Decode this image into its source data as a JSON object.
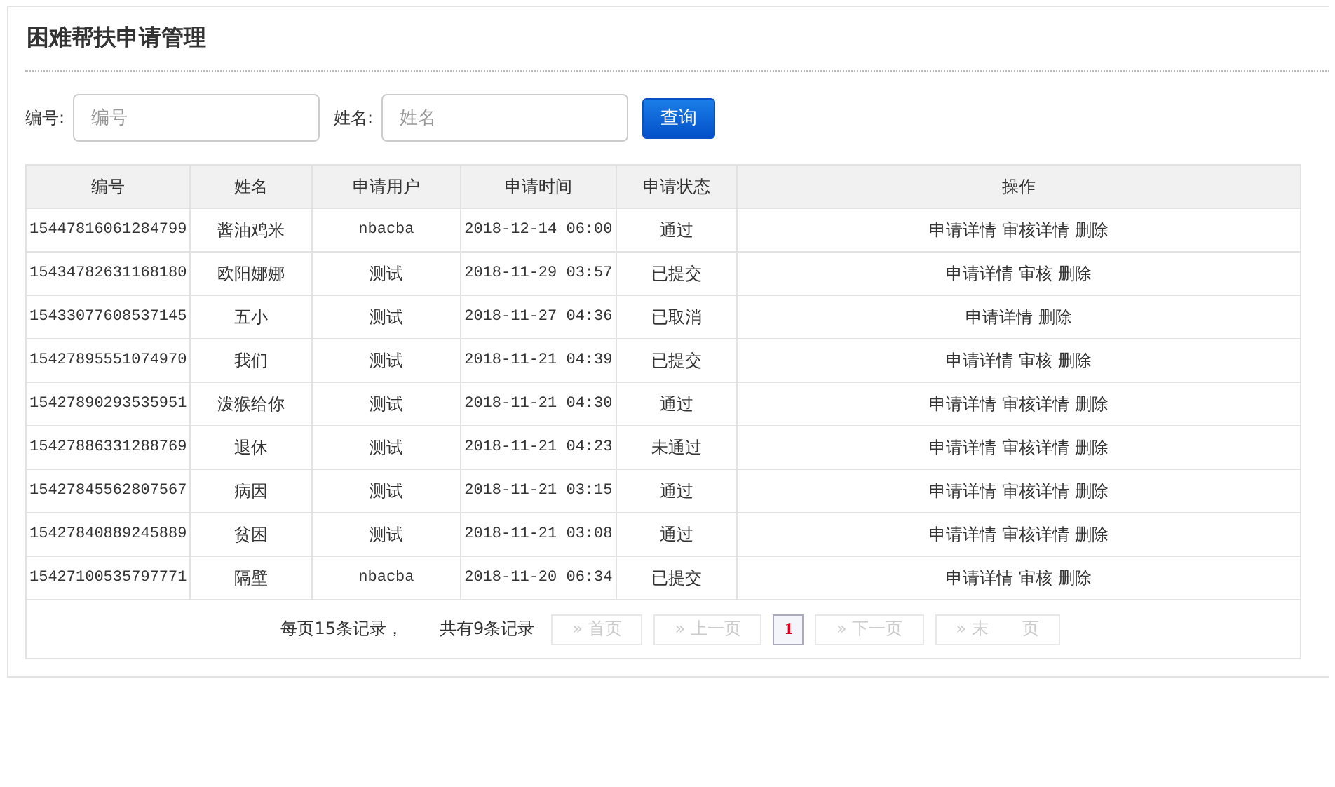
{
  "title": "困难帮扶申请管理",
  "search": {
    "fields": [
      {
        "label": "编号:",
        "placeholder": "编号"
      },
      {
        "label": "姓名:",
        "placeholder": "姓名"
      }
    ],
    "button": "查询"
  },
  "table": {
    "columns": [
      "编号",
      "姓名",
      "申请用户",
      "申请时间",
      "申请状态",
      "操作"
    ],
    "rows": [
      {
        "id": "15447816061284799",
        "name": "酱油鸡米",
        "user": "nbacba",
        "time": "2018-12-14 06:00",
        "status": "通过",
        "actions": [
          "申请详情",
          "审核详情",
          "删除"
        ]
      },
      {
        "id": "15434782631168180",
        "name": "欧阳娜娜",
        "user": "测试",
        "time": "2018-11-29 03:57",
        "status": "已提交",
        "actions": [
          "申请详情",
          "审核",
          "删除"
        ]
      },
      {
        "id": "15433077608537145",
        "name": "五小",
        "user": "测试",
        "time": "2018-11-27 04:36",
        "status": "已取消",
        "actions": [
          "申请详情",
          "删除"
        ]
      },
      {
        "id": "15427895551074970",
        "name": "我们",
        "user": "测试",
        "time": "2018-11-21 04:39",
        "status": "已提交",
        "actions": [
          "申请详情",
          "审核",
          "删除"
        ]
      },
      {
        "id": "15427890293535951",
        "name": "泼猴给你",
        "user": "测试",
        "time": "2018-11-21 04:30",
        "status": "通过",
        "actions": [
          "申请详情",
          "审核详情",
          "删除"
        ]
      },
      {
        "id": "15427886331288769",
        "name": "退休",
        "user": "测试",
        "time": "2018-11-21 04:23",
        "status": "未通过",
        "actions": [
          "申请详情",
          "审核详情",
          "删除"
        ]
      },
      {
        "id": "15427845562807567",
        "name": "病因",
        "user": "测试",
        "time": "2018-11-21 03:15",
        "status": "通过",
        "actions": [
          "申请详情",
          "审核详情",
          "删除"
        ]
      },
      {
        "id": "15427840889245889",
        "name": "贫困",
        "user": "测试",
        "time": "2018-11-21 03:08",
        "status": "通过",
        "actions": [
          "申请详情",
          "审核详情",
          "删除"
        ]
      },
      {
        "id": "15427100535797771",
        "name": "隔壁",
        "user": "nbacba",
        "time": "2018-11-20 06:34",
        "status": "已提交",
        "actions": [
          "申请详情",
          "审核",
          "删除"
        ]
      }
    ]
  },
  "pagination": {
    "per_page": "每页15条记录，",
    "total": "共有9条记录",
    "items": [
      {
        "label": "» 首页",
        "disabled": true,
        "selected": false
      },
      {
        "label": "» 上一页",
        "disabled": true,
        "selected": false
      },
      {
        "label": "1",
        "disabled": false,
        "selected": true
      },
      {
        "label": "» 下一页",
        "disabled": true,
        "selected": false
      },
      {
        "label": "» 末　　页",
        "disabled": true,
        "selected": false
      }
    ]
  }
}
